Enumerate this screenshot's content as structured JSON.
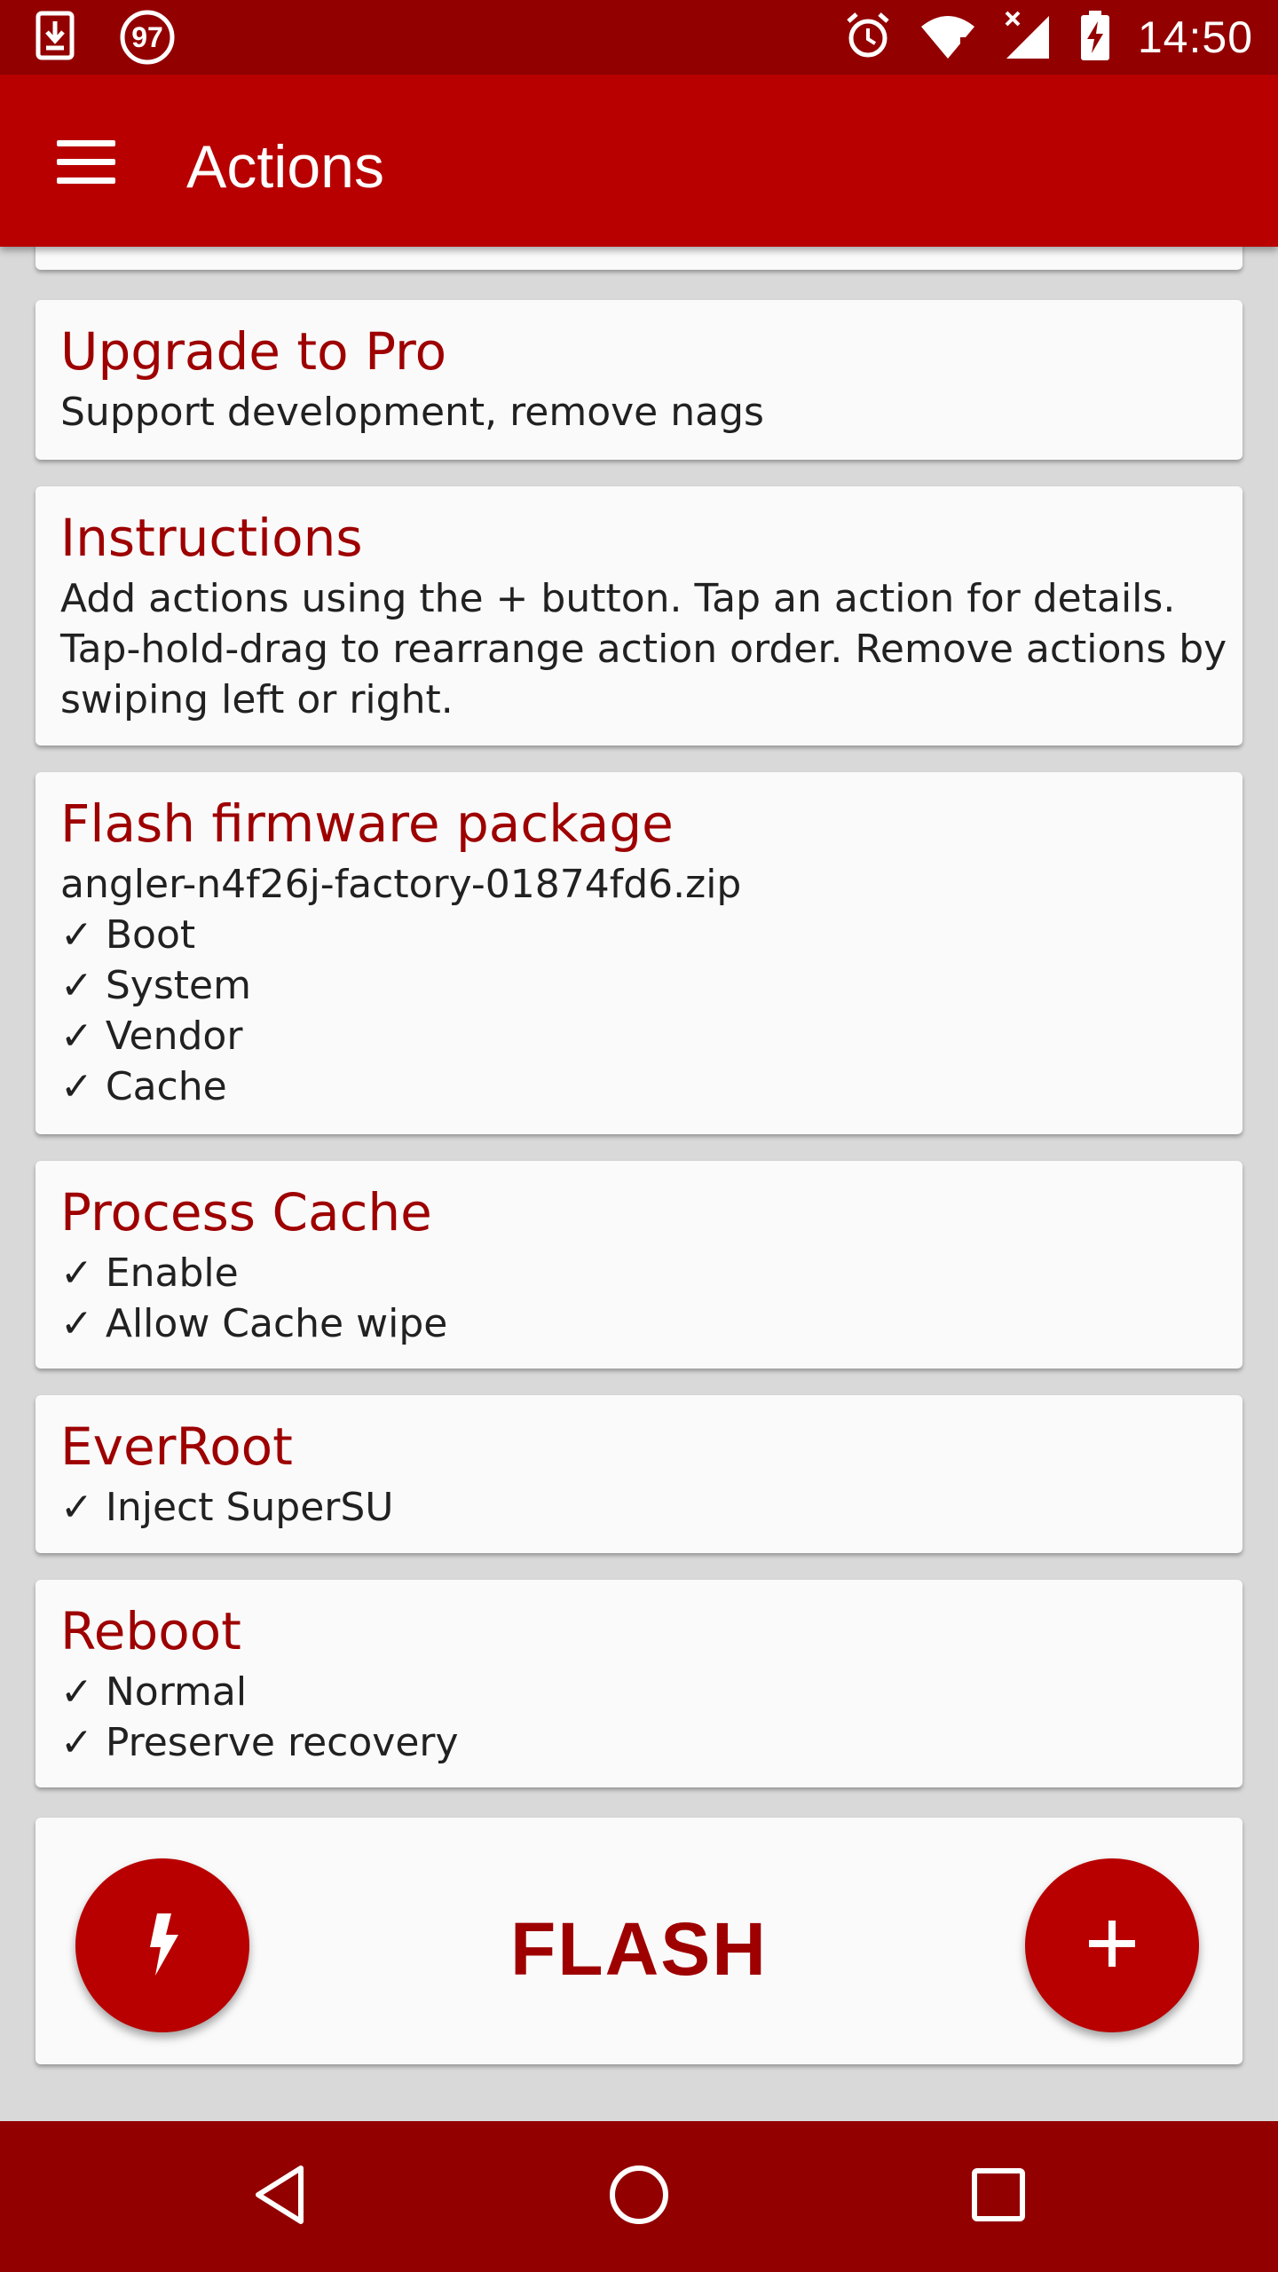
{
  "status_bar": {
    "time": "14:50",
    "notification_count": "97",
    "icons": [
      "download-icon",
      "alarm-icon",
      "wifi-icon",
      "signal-icon",
      "battery-charging-icon"
    ]
  },
  "app_bar": {
    "title": "Actions",
    "menu_icon": "hamburger-menu-icon"
  },
  "cards": [
    {
      "title": "Upgrade to Pro",
      "lines": [
        "Support development, remove nags"
      ]
    },
    {
      "title": "Instructions",
      "lines": [
        "Add actions using the + button. Tap an action for details.",
        "Tap-hold-drag to rearrange action order. Remove actions by",
        "swiping left or right."
      ]
    },
    {
      "title": "Flash firmware package",
      "lines": [
        "angler-n4f26j-factory-01874fd6.zip",
        "✓ Boot",
        "✓ System",
        "✓ Vendor",
        "✓ Cache"
      ]
    },
    {
      "title": "Process Cache",
      "lines": [
        "✓ Enable",
        "✓ Allow Cache wipe"
      ]
    },
    {
      "title": "EverRoot",
      "lines": [
        "✓ Inject SuperSU"
      ]
    },
    {
      "title": "Reboot",
      "lines": [
        "✓ Normal",
        "✓ Preserve recovery"
      ]
    }
  ],
  "flash_panel": {
    "label": "FLASH",
    "left_fab_icon": "lightning-bolt-icon",
    "right_fab_icon": "plus-icon"
  },
  "nav_bar": {
    "icons": [
      "back-icon",
      "home-icon",
      "recents-icon"
    ]
  },
  "colors": {
    "status_bar": "#930000",
    "app_bar": "#b80000",
    "accent_text": "#9e0000",
    "card_background": "#fafafa",
    "page_background": "#d9d9d9"
  }
}
